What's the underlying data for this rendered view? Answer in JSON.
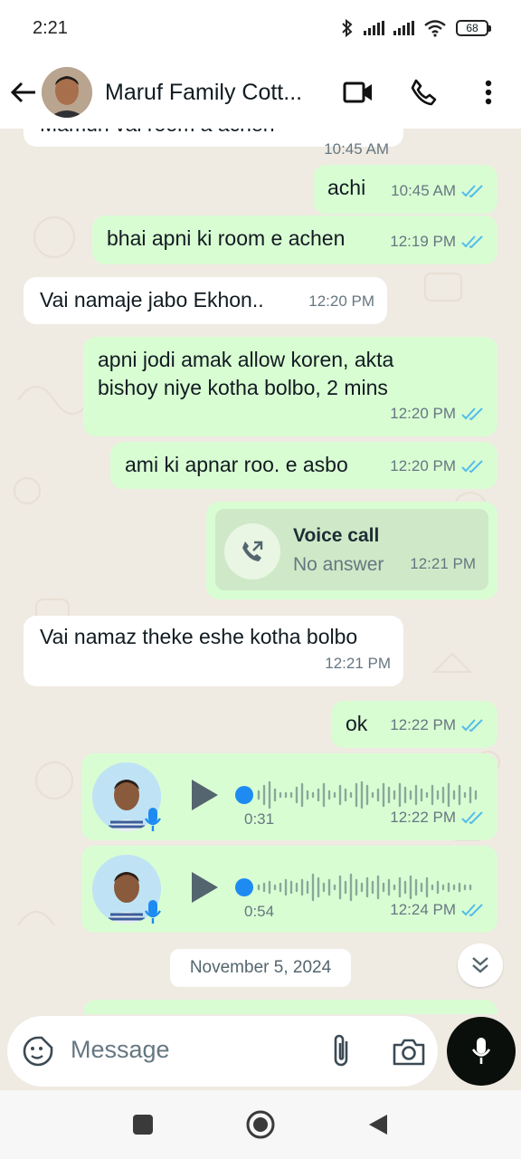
{
  "status_bar": {
    "time": "2:21",
    "battery": "68"
  },
  "header": {
    "title": "Maruf Family Cott..."
  },
  "messages": [
    {
      "type": "in",
      "text": "Mamun vai room a achen",
      "time": "10:45 AM"
    },
    {
      "type": "out",
      "text": "achi",
      "time": "10:45 AM"
    },
    {
      "type": "out",
      "text": "bhai apni ki room e achen",
      "time": "12:19 PM"
    },
    {
      "type": "in",
      "text": "Vai namaje jabo Ekhon..",
      "time": "12:20 PM"
    },
    {
      "type": "out",
      "text_line1": "apni jodi amak allow koren, akta",
      "text_line2": "bishoy niye kotha bolbo, 2 mins",
      "time": "12:20 PM"
    },
    {
      "type": "out",
      "text": "ami ki apnar roo. e asbo",
      "time": "12:20 PM"
    },
    {
      "type": "call",
      "title": "Voice call",
      "subtitle": "No answer",
      "time": "12:21 PM"
    },
    {
      "type": "in",
      "text": "Vai namaz theke eshe kotha bolbo",
      "time": "12:21 PM"
    },
    {
      "type": "out",
      "text": "ok",
      "time": "12:22 PM"
    },
    {
      "type": "voice",
      "duration": "0:31",
      "time": "12:22 PM"
    },
    {
      "type": "voice",
      "duration": "0:54",
      "time": "12:24 PM"
    }
  ],
  "date_chip": "November 5, 2024",
  "composer": {
    "placeholder": "Message"
  },
  "colors": {
    "outgoing": "#d9fdd3",
    "incoming": "#ffffff",
    "tick_blue": "#53bdeb",
    "progress_dot": "#1d8bf1"
  }
}
